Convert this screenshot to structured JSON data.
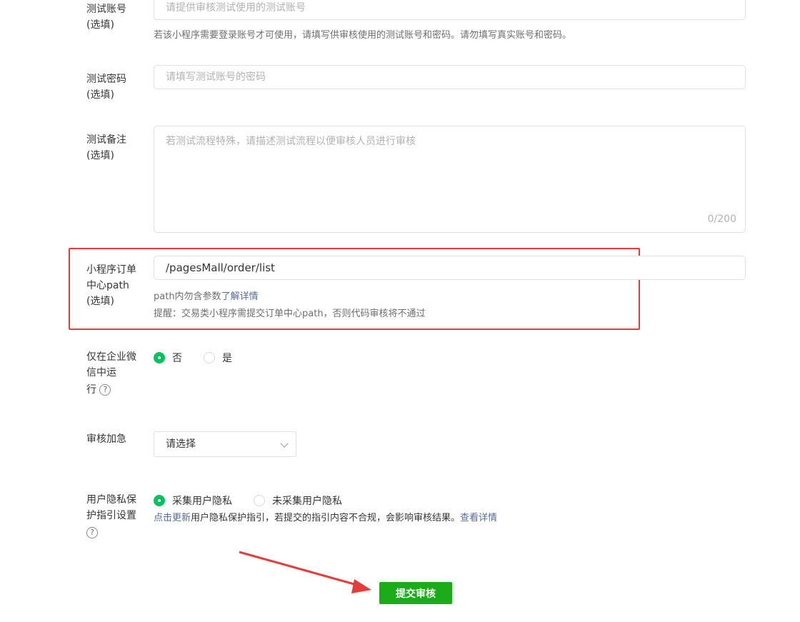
{
  "test_account": {
    "label_line1": "测试账号",
    "label_line2": "(选填)",
    "placeholder": "请提供审核测试使用的测试账号",
    "hint": "若该小程序需要登录账号才可使用，请填写供审核使用的测试账号和密码。请勿填写真实账号和密码。"
  },
  "test_password": {
    "label_line1": "测试密码",
    "label_line2": "(选填)",
    "placeholder": "请填写测试账号的密码"
  },
  "test_notes": {
    "label_line1": "测试备注",
    "label_line2": "(选填)",
    "placeholder": "若测试流程特殊，请描述测试流程以便审核人员进行审核",
    "counter": "0/200"
  },
  "order_path": {
    "label_line1": "小程序订单",
    "label_line2": "中心path",
    "label_line3": "(选填)",
    "value": "/pagesMall/order/list",
    "hint_prefix": "path内勿含参数",
    "hint_link": "了解详情",
    "reminder": "提醒：交易类小程序需提交订单中心path，否则代码审核将不通过"
  },
  "wework_only": {
    "label_line1": "仅在企业微",
    "label_line2": "信中运",
    "label_line3": "行",
    "help_glyph": "?",
    "options": [
      "否",
      "是"
    ],
    "selected": "否"
  },
  "expedite": {
    "label": "审核加急",
    "select_value": "请选择"
  },
  "privacy": {
    "label_line1": "用户隐私保",
    "label_line2": "护指引设置",
    "help_glyph": "?",
    "options": [
      "采集用户隐私",
      "未采集用户隐私"
    ],
    "selected": "采集用户隐私",
    "hint_link_update": "点击更新",
    "hint_text": "用户隐私保护指引，若提交的指引内容不合规，会影响审核结果。",
    "hint_link_view": "查看详情"
  },
  "submit_label": "提交审核",
  "colors": {
    "accent_green": "#07c160",
    "button_green": "#1aad19",
    "annotation_red": "#e53c3c",
    "link_blue": "#576b95"
  }
}
